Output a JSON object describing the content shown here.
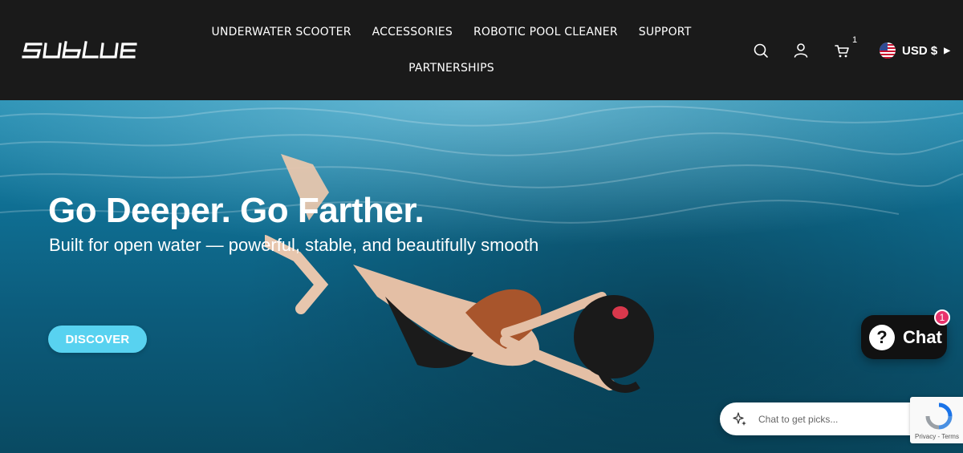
{
  "brand": {
    "logo_text": "SUBLUE"
  },
  "nav": {
    "items": [
      {
        "label": "UNDERWATER SCOOTER"
      },
      {
        "label": "ACCESSORIES"
      },
      {
        "label": "ROBOTIC POOL CLEANER"
      },
      {
        "label": "SUPPORT"
      },
      {
        "label": "PARTNERSHIPS"
      }
    ]
  },
  "header": {
    "icons": [
      "search-icon",
      "user-icon",
      "cart-icon",
      "us-flag-icon"
    ],
    "cart_count": "1",
    "currency": "USD $"
  },
  "hero": {
    "title": "Go Deeper. Go Farther.",
    "subtitle": "Built for open water — powerful, stable, and beautifully smooth",
    "cta": "DISCOVER"
  },
  "chat": {
    "label": "Chat",
    "question_mark": "?",
    "badge": "1",
    "input_placeholder": "Chat to get picks..."
  },
  "recaptcha": {
    "text": "Privacy - Terms"
  },
  "colors": {
    "header_bg": "#1a1a1a",
    "cta_bg": "#58d2f0",
    "badge": "#e8336c"
  }
}
